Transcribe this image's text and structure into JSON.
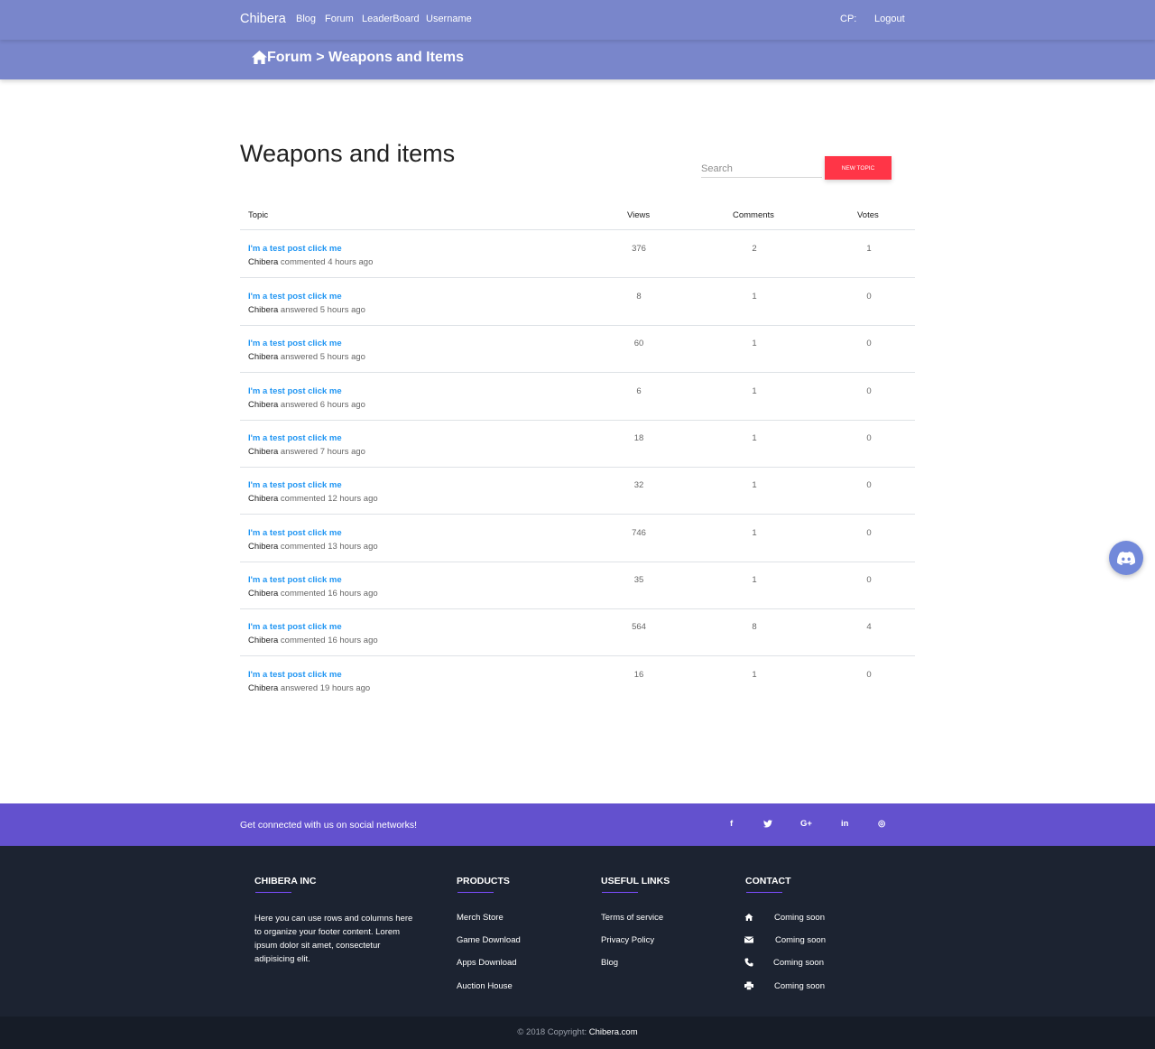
{
  "navbar": {
    "brand": "Chibera",
    "links": [
      "Blog",
      "Forum",
      "LeaderBoard",
      "Username"
    ],
    "cp": "CP:",
    "logout": "Logout",
    "color": "#7986cb"
  },
  "breadcrumb": {
    "text": "Forum > Weapons and Items",
    "icon": "home-icon"
  },
  "page": {
    "title": "Weapons and items",
    "search_placeholder": "Search",
    "new_topic_label": "New topic"
  },
  "table": {
    "headers": [
      "Topic",
      "Views",
      "Comments",
      "Votes"
    ],
    "rows": [
      {
        "title": "I'm a test post click me",
        "user": "Chibera",
        "action": "commented 4 hours ago",
        "views": "376",
        "comments": "2",
        "votes": "1"
      },
      {
        "title": "I'm a test post click me",
        "user": "Chibera",
        "action": "answered 5 hours ago",
        "views": "8",
        "comments": "1",
        "votes": "0"
      },
      {
        "title": "I'm a test post click me",
        "user": "Chibera",
        "action": "answered 5 hours ago",
        "views": "60",
        "comments": "1",
        "votes": "0"
      },
      {
        "title": "I'm a test post click me",
        "user": "Chibera",
        "action": "answered 6 hours ago",
        "views": "6",
        "comments": "1",
        "votes": "0"
      },
      {
        "title": "I'm a test post click me",
        "user": "Chibera",
        "action": "answered 7 hours ago",
        "views": "18",
        "comments": "1",
        "votes": "0"
      },
      {
        "title": "I'm a test post click me",
        "user": "Chibera",
        "action": "commented 12 hours ago",
        "views": "32",
        "comments": "1",
        "votes": "0"
      },
      {
        "title": "I'm a test post click me",
        "user": "Chibera",
        "action": "commented 13 hours ago",
        "views": "746",
        "comments": "1",
        "votes": "0"
      },
      {
        "title": "I'm a test post click me",
        "user": "Chibera",
        "action": "commented 16 hours ago",
        "views": "35",
        "comments": "1",
        "votes": "0"
      },
      {
        "title": "I'm a test post click me",
        "user": "Chibera",
        "action": "commented 16 hours ago",
        "views": "564",
        "comments": "8",
        "votes": "4"
      },
      {
        "title": "I'm a test post click me",
        "user": "Chibera",
        "action": "answered 19 hours ago",
        "views": "16",
        "comments": "1",
        "votes": "0"
      }
    ]
  },
  "social": {
    "text": "Get connected with us on social networks!",
    "icons": [
      "f",
      "🐦",
      "G+",
      "in",
      "◎"
    ],
    "icon_names": [
      "facebook-icon",
      "twitter-icon",
      "google-plus-icon",
      "linkedin-icon",
      "instagram-icon"
    ],
    "color": "#6351ce"
  },
  "footer": {
    "company": {
      "heading": "CHIBERA INC",
      "text": "Here you can use rows and columns here to organize your footer content. Lorem ipsum dolor sit amet, consectetur adipisicing elit."
    },
    "products": {
      "heading": "PRODUCTS",
      "links": [
        "Merch Store",
        "Game Download",
        "Apps Download",
        "Auction House"
      ]
    },
    "useful": {
      "heading": "USEFUL LINKS",
      "links": [
        "Terms of service",
        "Privacy Policy",
        "Blog"
      ]
    },
    "contact": {
      "heading": "CONTACT",
      "items": [
        "Coming soon",
        "Coming soon",
        "Coming soon",
        "Coming soon"
      ],
      "icons": [
        "home-icon",
        "envelope-icon",
        "phone-icon",
        "print-icon"
      ]
    }
  },
  "copyright": {
    "prefix": "© 2018 Copyright:",
    "link": "Chibera.com"
  },
  "colors": {
    "accent_red": "#ff3547",
    "link_blue": "#2196f3",
    "footer_bg": "#1c2331",
    "discord": "#7289da"
  }
}
